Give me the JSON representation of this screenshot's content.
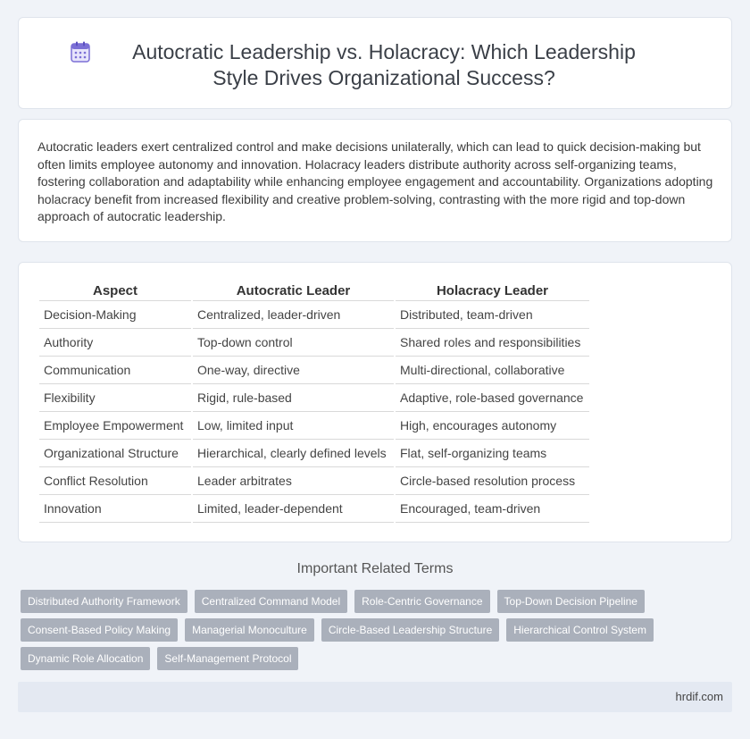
{
  "header": {
    "icon": "calendar-icon",
    "title": "Autocratic Leadership vs. Holacracy: Which Leadership Style Drives Organizational Success?"
  },
  "summary": {
    "text": "Autocratic leaders exert centralized control and make decisions unilaterally, which can lead to quick decision-making but often limits employee autonomy and innovation. Holacracy leaders distribute authority across self-organizing teams, fostering collaboration and adaptability while enhancing employee engagement and accountability. Organizations adopting holacracy benefit from increased flexibility and creative problem-solving, contrasting with the more rigid and top-down approach of autocratic leadership."
  },
  "table": {
    "headers": [
      "Aspect",
      "Autocratic Leader",
      "Holacracy Leader"
    ],
    "rows": [
      [
        "Decision-Making",
        "Centralized, leader-driven",
        "Distributed, team-driven"
      ],
      [
        "Authority",
        "Top-down control",
        "Shared roles and responsibilities"
      ],
      [
        "Communication",
        "One-way, directive",
        "Multi-directional, collaborative"
      ],
      [
        "Flexibility",
        "Rigid, rule-based",
        "Adaptive, role-based governance"
      ],
      [
        "Employee Empowerment",
        "Low, limited input",
        "High, encourages autonomy"
      ],
      [
        "Organizational Structure",
        "Hierarchical, clearly defined levels",
        "Flat, self-organizing teams"
      ],
      [
        "Conflict Resolution",
        "Leader arbitrates",
        "Circle-based resolution process"
      ],
      [
        "Innovation",
        "Limited, leader-dependent",
        "Encouraged, team-driven"
      ]
    ]
  },
  "related": {
    "title": "Important Related Terms",
    "terms": [
      "Distributed Authority Framework",
      "Centralized Command Model",
      "Role-Centric Governance",
      "Top-Down Decision Pipeline",
      "Consent-Based Policy Making",
      "Managerial Monoculture",
      "Circle-Based Leadership Structure",
      "Hierarchical Control System",
      "Dynamic Role Allocation",
      "Self-Management Protocol"
    ]
  },
  "footer": {
    "site": "hrdif.com"
  },
  "colors": {
    "background": "#f0f3f8",
    "tag": "#aab0bb",
    "footer": "#e4e9f2",
    "icon_accent": "#7b6fd6"
  }
}
